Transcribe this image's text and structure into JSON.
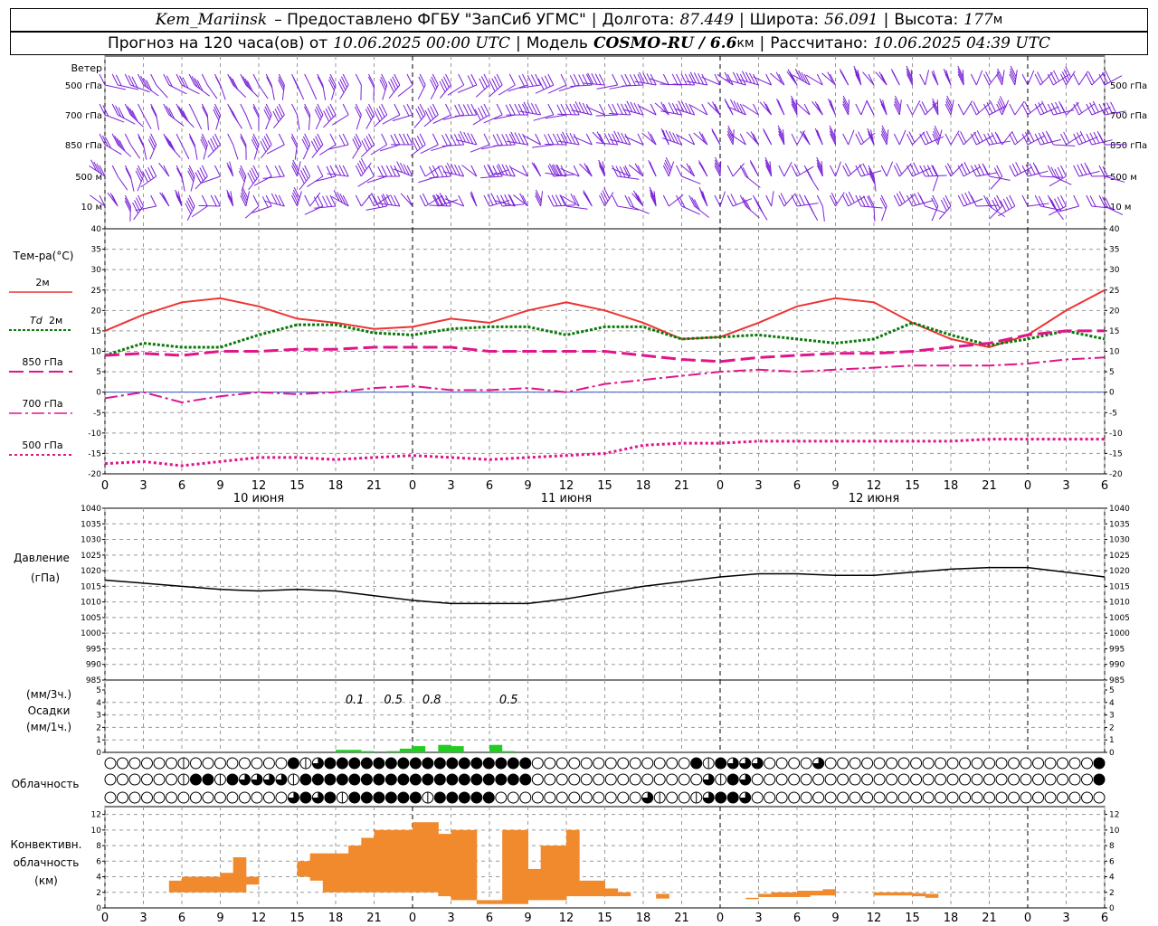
{
  "header": {
    "station": "Kem_Mariinsk",
    "provider": "– Предоставлено ФГБУ \"ЗапСиб УГМС\"",
    "lon_label": "Долгота:",
    "lon_value": "87.449",
    "lat_label": "Широта:",
    "lat_value": "56.091",
    "alt_label": "Высота:",
    "alt_value": "177",
    "alt_unit": "м",
    "forecast_label": "Прогноз на 120 часа(ов) от",
    "forecast_start": "10.06.2025 00:00 UTC",
    "model_label": "Модель",
    "model_name": "COSMO-RU / 6.6",
    "model_unit": "км",
    "calc_label": "Рассчитано:",
    "calc_time": "10.06.2025 04:39 UTC"
  },
  "labels": {
    "wind": "Ветер",
    "wind_levels": [
      "500 гПа",
      "700 гПа",
      "850 гПа",
      "500 м",
      "10 м"
    ],
    "temp_title": "Тем-ра(°C)",
    "temp_legend": [
      "2м",
      "Td 2м",
      "850 гПа",
      "700 гПа",
      "500 гПа"
    ],
    "pressure_title": "Давление",
    "pressure_unit": "(гПа)",
    "precip_3h": "(мм/3ч.)",
    "precip_title": "Осадки",
    "precip_1h": "(мм/1ч.)",
    "cloud_title": "Облачность",
    "conv_title": [
      "Конвективн.",
      "облачность",
      "(км)"
    ]
  },
  "colors": {
    "t2m": "#ee3333",
    "td2m": "#0a7a0a",
    "t850": "#e0158a",
    "t700": "#e0158a",
    "t500": "#e0158a",
    "wind": "#7a22d6",
    "precip": "#22cc22",
    "conv": "#f08a2c",
    "pressure": "#000000"
  },
  "chart_data": [
    {
      "type": "line",
      "name": "temperature",
      "x_hours": [
        0,
        3,
        6,
        9,
        12,
        15,
        18,
        21,
        24,
        27,
        30,
        33,
        36,
        39,
        42,
        45,
        48,
        51,
        54,
        57,
        60,
        63,
        66,
        69,
        72,
        75,
        78
      ],
      "x_tick_labels": [
        "0",
        "3",
        "6",
        "9",
        "12",
        "15",
        "18",
        "21",
        "0",
        "3",
        "6",
        "9",
        "12",
        "15",
        "18",
        "21",
        "0",
        "3",
        "6",
        "9",
        "12",
        "15",
        "18",
        "21",
        "0",
        "3",
        "6"
      ],
      "day_labels": [
        "10 июня",
        "11 июня",
        "12 июня"
      ],
      "ylim": [
        -20,
        40
      ],
      "yticks": [
        -20,
        -15,
        -10,
        -5,
        0,
        5,
        10,
        15,
        20,
        25,
        30,
        35,
        40
      ],
      "series": [
        {
          "name": "2м",
          "values": [
            15,
            19,
            22,
            23,
            21,
            18,
            17,
            15.5,
            16,
            18,
            17,
            20,
            22,
            20,
            17,
            13,
            13.5,
            17,
            21,
            23,
            22,
            17,
            13,
            11,
            14,
            20,
            25
          ]
        },
        {
          "name": "Td 2м",
          "values": [
            9,
            12,
            11,
            11,
            14,
            16.5,
            16.5,
            14.5,
            14,
            15.5,
            16,
            16,
            14,
            16,
            16,
            13,
            13.5,
            14,
            13,
            12,
            13,
            17,
            14,
            11.5,
            13,
            15,
            13
          ]
        },
        {
          "name": "850 гПа",
          "values": [
            9,
            9.5,
            9,
            10,
            10,
            10.5,
            10.5,
            11,
            11,
            11,
            10,
            10,
            10,
            10,
            9,
            8,
            7.5,
            8.5,
            9,
            9.5,
            9.5,
            10,
            11,
            12,
            14,
            15,
            15
          ]
        },
        {
          "name": "700 гПа",
          "values": [
            -1.5,
            0,
            -2.5,
            -1,
            0,
            -0.5,
            0,
            1,
            1.5,
            0.5,
            0.5,
            1,
            0,
            2,
            3,
            4,
            5,
            5.5,
            5,
            5.5,
            6,
            6.5,
            6.5,
            6.5,
            7,
            8,
            8.5
          ]
        },
        {
          "name": "500 гПа",
          "values": [
            -17.5,
            -17,
            -18,
            -17,
            -16,
            -16,
            -16.5,
            -16,
            -15.5,
            -16,
            -16.5,
            -16,
            -15.5,
            -15,
            -13,
            -12.5,
            -12.5,
            -12,
            -12,
            -12,
            -12,
            -12,
            -12,
            -11.5,
            -11.5,
            -11.5,
            -11.5
          ]
        }
      ]
    },
    {
      "type": "line",
      "name": "pressure",
      "x_hours": [
        0,
        3,
        6,
        9,
        12,
        15,
        18,
        21,
        24,
        27,
        30,
        33,
        36,
        39,
        42,
        45,
        48,
        51,
        54,
        57,
        60,
        63,
        66,
        69,
        72,
        75,
        78
      ],
      "ylim": [
        985,
        1040
      ],
      "yticks": [
        985,
        990,
        995,
        1000,
        1005,
        1010,
        1015,
        1020,
        1025,
        1030,
        1035,
        1040
      ],
      "series": [
        {
          "name": "Давление",
          "values": [
            1017,
            1016,
            1015,
            1014,
            1013.5,
            1014,
            1013.5,
            1012,
            1010.5,
            1009.5,
            1009.5,
            1009.5,
            1011,
            1013,
            1015,
            1016.5,
            1018,
            1019,
            1019,
            1018.5,
            1018.5,
            1019.5,
            1020.5,
            1021,
            1021,
            1019.5,
            1018
          ]
        }
      ]
    },
    {
      "type": "bar",
      "name": "precipitation",
      "ylim": [
        0,
        5
      ],
      "yticks": [
        0,
        1,
        2,
        3,
        4,
        5
      ],
      "bars_1h": [
        [
          18,
          0.2
        ],
        [
          19,
          0.2
        ],
        [
          20,
          0.1
        ],
        [
          22,
          0.1
        ],
        [
          23,
          0.3
        ],
        [
          24,
          0.5
        ],
        [
          26,
          0.6
        ],
        [
          27,
          0.5
        ],
        [
          30,
          0.6
        ],
        [
          31,
          0.1
        ]
      ],
      "labels_3h": [
        [
          19.5,
          "0.1"
        ],
        [
          22.5,
          "0.5"
        ],
        [
          25.5,
          "0.8"
        ],
        [
          31.5,
          "0.5"
        ]
      ]
    },
    {
      "type": "table",
      "name": "cloudiness",
      "rows": [
        "0000001000000004134444444444444444400000000000004143330000300000000000000000000004",
        "0000001441433331444444444444444444400000000000000314300000000000000000000000000004",
        "0000000000000003434144444414444400000000000031001344300000000000000000000000000000"
      ]
    },
    {
      "type": "bar",
      "name": "convective_cloud",
      "ylim": [
        0,
        13
      ],
      "yticks": [
        0,
        2,
        4,
        6,
        8,
        10,
        12
      ],
      "bars": [
        [
          5,
          2,
          3.5
        ],
        [
          6,
          2,
          4
        ],
        [
          7,
          2,
          4
        ],
        [
          8,
          2,
          4
        ],
        [
          9,
          2,
          4.5
        ],
        [
          10,
          2,
          6.5
        ],
        [
          11,
          3,
          4
        ],
        [
          15,
          4,
          6
        ],
        [
          16,
          3.5,
          7
        ],
        [
          17,
          2,
          7
        ],
        [
          18,
          2,
          7
        ],
        [
          19,
          2,
          8
        ],
        [
          20,
          2,
          9
        ],
        [
          21,
          2,
          10
        ],
        [
          22,
          2,
          10
        ],
        [
          23,
          2,
          10
        ],
        [
          24,
          2,
          11
        ],
        [
          25,
          2,
          11
        ],
        [
          26,
          1.5,
          9.5
        ],
        [
          27,
          1,
          10
        ],
        [
          28,
          1,
          10
        ],
        [
          29,
          0.5,
          1
        ],
        [
          30,
          0.5,
          1
        ],
        [
          31,
          0.5,
          10
        ],
        [
          32,
          0.5,
          10
        ],
        [
          33,
          1,
          5
        ],
        [
          34,
          1,
          8
        ],
        [
          35,
          1,
          8
        ],
        [
          36,
          1.5,
          10
        ],
        [
          37,
          1.5,
          3.5
        ],
        [
          38,
          1.5,
          3.5
        ],
        [
          39,
          1.5,
          2.5
        ],
        [
          40,
          1.5,
          2
        ],
        [
          43,
          1.2,
          1.8
        ],
        [
          50,
          1.2,
          1.3
        ],
        [
          51,
          1.4,
          1.8
        ],
        [
          52,
          1.4,
          2
        ],
        [
          53,
          1.4,
          2
        ],
        [
          54,
          1.4,
          2.2
        ],
        [
          55,
          1.6,
          2.2
        ],
        [
          56,
          1.6,
          2.4
        ],
        [
          60,
          1.6,
          2
        ],
        [
          61,
          1.6,
          2
        ],
        [
          62,
          1.6,
          2
        ],
        [
          63,
          1.5,
          1.9
        ],
        [
          64,
          1.3,
          1.8
        ]
      ]
    }
  ]
}
